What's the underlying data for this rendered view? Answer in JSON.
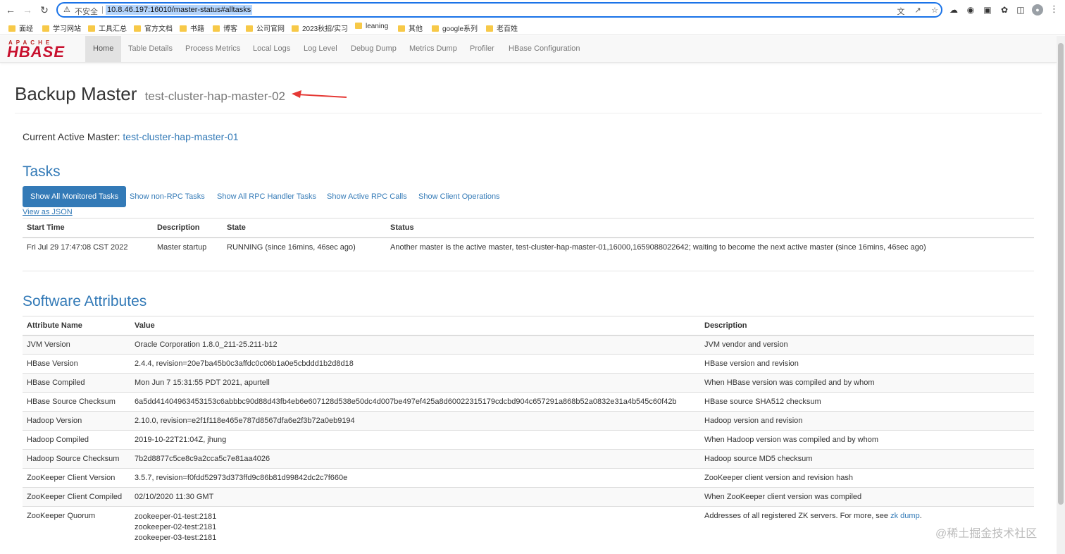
{
  "browser": {
    "insecure_label": "不安全",
    "separator": "|",
    "url": "10.8.46.197:16010/master-status#alltasks",
    "bookmarks": [
      "面经",
      "学习网站",
      "工具汇总",
      "官方文档",
      "书籍",
      "博客",
      "公司官网",
      "2023秋招/实习",
      "leaning",
      "其他",
      "google系列",
      "老百姓"
    ]
  },
  "navbar": {
    "logo_top": "APACHE",
    "logo_main": "HBASE",
    "items": [
      "Home",
      "Table Details",
      "Process Metrics",
      "Local Logs",
      "Log Level",
      "Debug Dump",
      "Metrics Dump",
      "Profiler",
      "HBase Configuration"
    ],
    "active": "Home"
  },
  "header": {
    "title": "Backup Master",
    "subtitle": "test-cluster-hap-master-02"
  },
  "active_master": {
    "label": "Current Active Master:",
    "value": "test-cluster-hap-master-01"
  },
  "tasks": {
    "heading": "Tasks",
    "tabs": [
      "Show All Monitored Tasks",
      "Show non-RPC Tasks",
      "Show All RPC Handler Tasks",
      "Show Active RPC Calls",
      "Show Client Operations"
    ],
    "json_link": "View as JSON",
    "columns": [
      "Start Time",
      "Description",
      "State",
      "Status"
    ],
    "rows": [
      {
        "start": "Fri Jul 29 17:47:08 CST 2022",
        "description": "Master startup",
        "state": "RUNNING (since 16mins, 46sec ago)",
        "status": "Another master is the active master, test-cluster-hap-master-01,16000,1659088022642; waiting to become the next active master (since 16mins, 46sec ago)"
      }
    ]
  },
  "software": {
    "heading": "Software Attributes",
    "columns": [
      "Attribute Name",
      "Value",
      "Description"
    ],
    "rows": [
      {
        "name": "JVM Version",
        "value": "Oracle Corporation 1.8.0_211-25.211-b12",
        "desc": "JVM vendor and version"
      },
      {
        "name": "HBase Version",
        "value": "2.4.4, revision=20e7ba45b0c3affdc0c06b1a0e5cbddd1b2d8d18",
        "desc": "HBase version and revision"
      },
      {
        "name": "HBase Compiled",
        "value": "Mon Jun 7 15:31:55 PDT 2021, apurtell",
        "desc": "When HBase version was compiled and by whom"
      },
      {
        "name": "HBase Source Checksum",
        "value": "6a5dd41404963453153c6abbbc90d88d43fb4eb6e607128d538e50dc4d007be497ef425a8d60022315179cdcbd904c657291a868b52a0832e31a4b545c60f42b",
        "desc": "HBase source SHA512 checksum"
      },
      {
        "name": "Hadoop Version",
        "value": "2.10.0, revision=e2f1f118e465e787d8567dfa6e2f3b72a0eb9194",
        "desc": "Hadoop version and revision"
      },
      {
        "name": "Hadoop Compiled",
        "value": "2019-10-22T21:04Z, jhung",
        "desc": "When Hadoop version was compiled and by whom"
      },
      {
        "name": "Hadoop Source Checksum",
        "value": "7b2d8877c5ce8c9a2cca5c7e81aa4026",
        "desc": "Hadoop source MD5 checksum"
      },
      {
        "name": "ZooKeeper Client Version",
        "value": "3.5.7, revision=f0fdd52973d373ffd9c86b81d99842dc2c7f660e",
        "desc": "ZooKeeper client version and revision hash"
      },
      {
        "name": "ZooKeeper Client Compiled",
        "value": "02/10/2020 11:30 GMT",
        "desc": "When ZooKeeper client version was compiled"
      }
    ],
    "quorum": {
      "name": "ZooKeeper Quorum",
      "servers": [
        "zookeeper-01-test:2181",
        "zookeeper-02-test:2181",
        "zookeeper-03-test:2181"
      ],
      "desc_prefix": "Addresses of all registered ZK servers. For more, see",
      "desc_link": "zk dump",
      "desc_suffix": "."
    }
  },
  "watermark": "@稀土掘金技术社区",
  "colors": {
    "link": "#337ab7",
    "pill_active_bg": "#337ab7",
    "logo_red": "#c8102e",
    "annotation_arrow": "#e53935",
    "omnibox_focus": "#1a73e8"
  }
}
